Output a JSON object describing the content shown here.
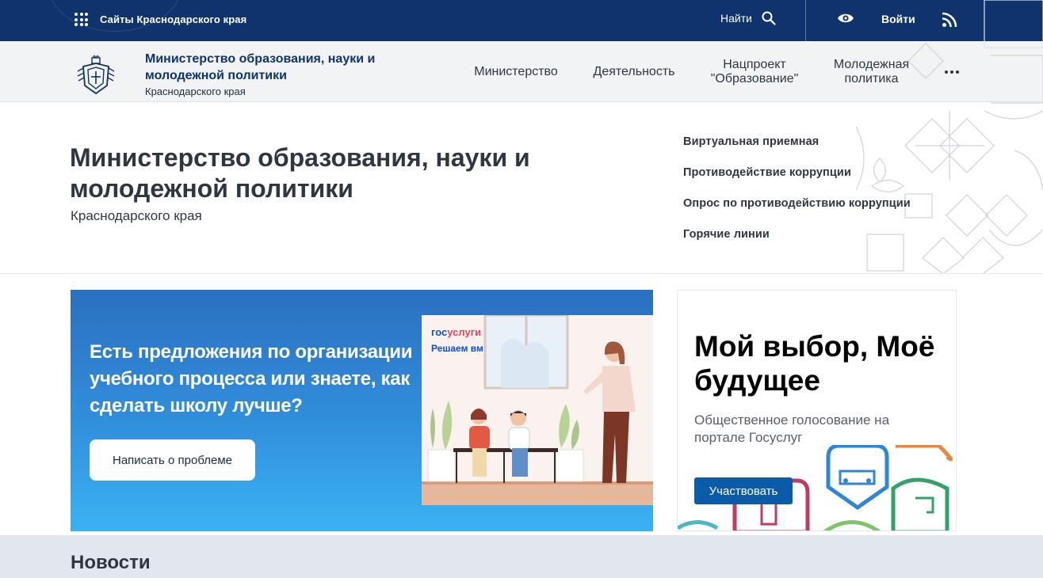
{
  "topbar": {
    "sites_label": "Сайты Краснодарского края",
    "find_label": "Найти",
    "login_label": "Войти"
  },
  "header": {
    "org_name": "Министерство образования, науки и молодежной политики",
    "org_sub": "Краснодарского края",
    "nav": [
      "Министерство",
      "Деятельность",
      "Нацпроект \"Образование\"",
      "Молодежная политика"
    ]
  },
  "hero": {
    "title": "Министерство образования, науки и молодежной политики",
    "subtitle": "Краснодарского края",
    "links": [
      "Виртуальная приемная",
      "Противодействие коррупции",
      "Опрос по противодействию коррупции",
      "Горячие линии"
    ]
  },
  "banner": {
    "text": "Есть предложения по организации учебного процесса или знаете, как сделать школу лучше?",
    "button": "Написать о проблеме",
    "gos_prefix": "гос",
    "gos_suffix": "услуги",
    "gos_tagline": "Решаем вместе"
  },
  "card": {
    "title": "Мой выбор, Моё будущее",
    "description": "Общественное голосование на портале Госуслуг",
    "button": "Участвовать"
  },
  "news": {
    "heading": "Новости"
  },
  "colors": {
    "topbar": "#0f336d",
    "brand_text": "#0f336d",
    "card_button": "#0b5ba9"
  }
}
